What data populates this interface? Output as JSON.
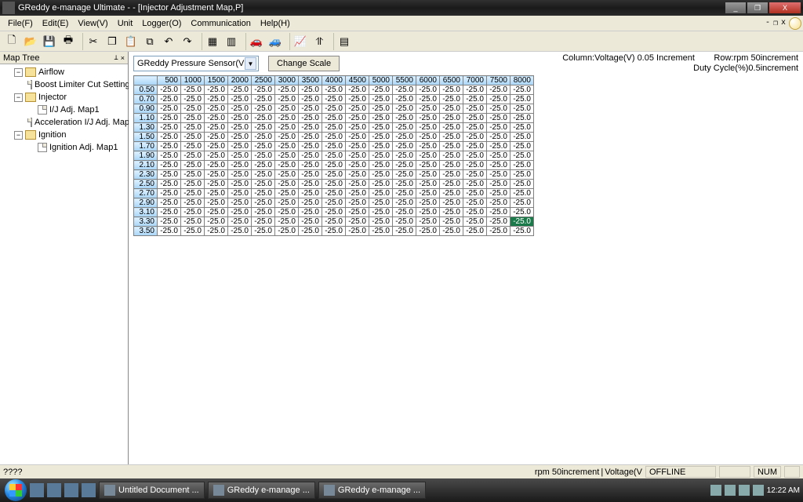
{
  "window": {
    "title": "GReddy e-manage Ultimate  -  - [Injector Adjustment Map,P]",
    "min": "_",
    "max": "❐",
    "close": "X",
    "mdi_min": "-",
    "mdi_restore": "❐",
    "mdi_close": "x"
  },
  "menubar": {
    "file": "File(F)",
    "edit": "Edit(E)",
    "view": "View(V)",
    "unit": "Unit",
    "logger": "Logger(O)",
    "comm": "Communication",
    "help": "Help(H)"
  },
  "toolbar_icons": {
    "new": "🗋",
    "open": "📂",
    "save": "💾",
    "print": "🖶",
    "cut": "✂",
    "copy": "❐",
    "paste": "📋",
    "pasteSp": "⧉",
    "undo": "↶",
    "redo": "↷",
    "grid": "▦",
    "chart": "▥",
    "car": "🚗",
    "car2": "🚙",
    "graph": "📈",
    "pick": "⥣",
    "sep": " ",
    "toggle": "▤"
  },
  "tree": {
    "header": "Map Tree",
    "airflow": "Airflow",
    "boost": "Boost Limiter Cut Setting",
    "injector": "Injector",
    "ij_map1": "I/J Adj. Map1",
    "acc_ij": "Acceleration I/J Adj. Map",
    "ignition": "Ignition",
    "ign_map1": "Ignition Adj. Map1"
  },
  "content": {
    "sensor_combo": "GReddy Pressure Sensor(V",
    "change_scale": "Change Scale",
    "info_col": "Column:Voltage(V) 0.05 Increment",
    "info_row": "Row:rpm 50increment",
    "info_duty": "Duty Cycle(%)0.5increment"
  },
  "grid": {
    "cols": [
      "500",
      "1000",
      "1500",
      "2000",
      "2500",
      "3000",
      "3500",
      "4000",
      "4500",
      "5000",
      "5500",
      "6000",
      "6500",
      "7000",
      "7500",
      "8000"
    ],
    "rows": [
      "0.50",
      "0.70",
      "0.90",
      "1.10",
      "1.30",
      "1.50",
      "1.70",
      "1.90",
      "2.10",
      "2.30",
      "2.50",
      "2.70",
      "2.90",
      "3.10",
      "3.30",
      "3.50"
    ],
    "value": "-25.0",
    "selected": {
      "row": 14,
      "col": 15
    }
  },
  "statusbar": {
    "left": "????",
    "rpm": "rpm 50increment",
    "volt": "Voltage(V",
    "off": "OFFLINE",
    "num": "NUM"
  },
  "taskbar": {
    "task1": "Untitled Document ...",
    "task2": "GReddy e-manage ...",
    "task3": "GReddy e-manage ...",
    "clock": "12:22 AM"
  }
}
